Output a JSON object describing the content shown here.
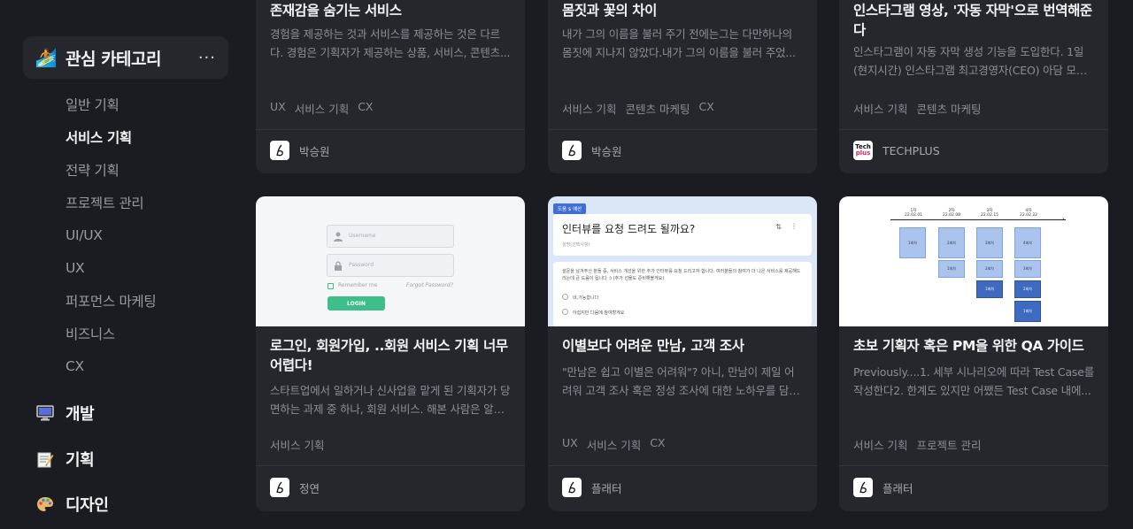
{
  "sidebar": {
    "category_header": {
      "emoji": "🏄",
      "title": "관심 카테고리",
      "more": "···"
    },
    "sub_items": [
      "일반 기획",
      "서비스 기획",
      "전략 기획",
      "프로젝트 관리",
      "UI/UX",
      "UX",
      "퍼포먼스 마케팅",
      "비즈니스",
      "CX"
    ],
    "active_sub": "서비스 기획",
    "main_categories": [
      {
        "label": "개발",
        "icon": "desktop-icon",
        "emoji": "🖥️"
      },
      {
        "label": "기획",
        "icon": "memo-icon",
        "emoji": "📝"
      },
      {
        "label": "디자인",
        "icon": "palette-icon",
        "emoji": "🎨"
      }
    ]
  },
  "cards_row1": [
    {
      "title": "존재감을 숨기는 서비스",
      "desc": "경험을 제공하는 것과 서비스를 제공하는 것은 다르다. 경험은 기획자가 제공하는 상품, 서비스, 콘텐츠...",
      "tags": [
        "UX",
        "서비스 기획",
        "CX"
      ],
      "author": "박승원"
    },
    {
      "title": "몸짓과 꽃의 차이",
      "desc": "내가 그의 이름을 불러 주기 전에는그는 다만하나의 몸짓에 지나지 않았다.내가 그의 이름을 불러 주었...",
      "tags": [
        "서비스 기획",
        "콘텐츠 마케팅",
        "CX"
      ],
      "author": "박승원"
    },
    {
      "title": "인스타그램 영상, '자동 자막'으로 번역해준다",
      "desc": "인스타그램이 자동 자막 생성 기능을 도입한다. 1일(현지시간) 인스타그램 최고경영자(CEO) 아담 모세리...",
      "tags": [
        "서비스 기획",
        "콘텐츠 마케팅"
      ],
      "author": "TECHPLUS"
    }
  ],
  "cards_row2": [
    {
      "title": "로그인, 회원가입, ..회원 서비스 기획 너무 어렵다!",
      "desc": "스타트업에서 일하거나 신사업을 맡게 된 기획자가 당면하는 과제 중 하나, 회원 서비스. 해본 사람은 알겠...",
      "tags": [
        "서비스 기획"
      ],
      "author": "정연"
    },
    {
      "title": "이별보다 어려운 만남, 고객 조사",
      "desc": "\"만남은 쉽고 이별은 어려워\"? 아니, 만남이 제일 어려워 고객 조사 혹은 정성 조사에 대한 노하우를 담은 ...",
      "tags": [
        "UX",
        "서비스 기획",
        "CX"
      ],
      "author": "플래터"
    },
    {
      "title": "초보 기획자 혹은 PM을 위한 QA 가이드",
      "desc": "Previously....1. 세부 시나리오에 따라 Test Case를 작성한다2. 한계도 있지만 어쨌든 Test Case 내에...",
      "tags": [
        "서비스 기획",
        "프로젝트 관리"
      ],
      "author": "플래터"
    }
  ],
  "thumb_login": {
    "username": "Username",
    "password": "Password",
    "remember": "Remember me",
    "forgot": "Forgot Password?",
    "button": "LOGIN"
  },
  "thumb_survey": {
    "badge": "도움 $ 예산",
    "question": "인터뷰를 요청 드려도 될까요?",
    "sub": "설명(선택사항)",
    "body": "설문을 남겨주신 분들 중, 서비스 개선을 위한 추가 인터뷰를 요청 드리고자 합니다. 여러분들의 참여가 더 나은 서비스를 제공해드리는데 큰 도움이 됩니다 :) (추가 선물도 준비해볼게요)",
    "opt1": "네,가능합니다",
    "opt2": "아쉽지만 다음에 참여할게요"
  },
  "thumb_qa": {
    "columns": [
      {
        "head": "1차",
        "date": "22.02.01"
      },
      {
        "head": "2차",
        "date": "22.02.08"
      },
      {
        "head": "3차",
        "date": "22.02.15"
      },
      {
        "head": "4차",
        "date": "22.02.22"
      }
    ],
    "round1": "1회차",
    "round2": "2회차",
    "round3": "3회차",
    "round4": "4회차"
  }
}
